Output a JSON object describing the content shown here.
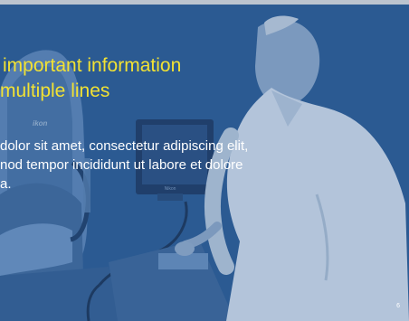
{
  "slide": {
    "title_lines": [
      "important information",
      "multiple lines"
    ],
    "body_lines": [
      "dolor sit amet, consectetur adipiscing elit,",
      "nod tempor incididunt ut labore et dolore",
      "a."
    ],
    "page_number": "6"
  },
  "photo": {
    "device_logo": "ikon",
    "monitor_brand": "Nikon"
  },
  "colors": {
    "background": "#2f5f95",
    "title": "#f2e233",
    "body_text": "#ffffff"
  }
}
